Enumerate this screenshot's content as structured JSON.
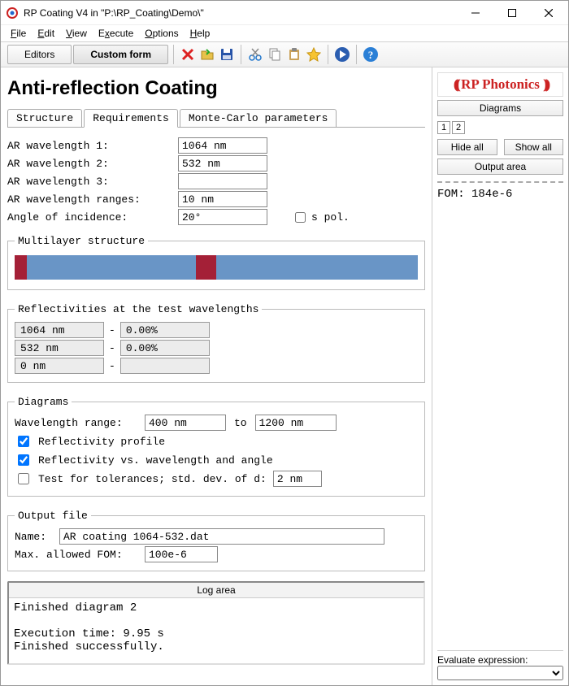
{
  "window": {
    "title": "RP Coating V4 in \"P:\\RP_Coating\\Demo\\\""
  },
  "menubar": [
    "File",
    "Edit",
    "View",
    "Execute",
    "Options",
    "Help"
  ],
  "toolbar": {
    "editors": "Editors",
    "custom": "Custom form"
  },
  "page": {
    "heading": "Anti-reflection Coating",
    "tabs": [
      "Structure",
      "Requirements",
      "Monte-Carlo parameters"
    ],
    "activeTab": 1,
    "fields": {
      "ar1_label": "AR wavelength 1:",
      "ar1_value": "1064 nm",
      "ar2_label": "AR wavelength 2:",
      "ar2_value": "532 nm",
      "ar3_label": "AR wavelength 3:",
      "ar3_value": "",
      "arranges_label": "AR wavelength ranges:",
      "arranges_value": "10 nm",
      "angle_label": "Angle of incidence:",
      "angle_value": "20°",
      "spol_label": "s pol."
    },
    "multi": {
      "legend": "Multilayer structure",
      "segments": [
        {
          "class": "dark",
          "w": 3
        },
        {
          "class": "light",
          "w": 42
        },
        {
          "class": "dark",
          "w": 5
        },
        {
          "class": "light",
          "w": 50
        }
      ]
    },
    "refl": {
      "legend": "Reflectivities at the test wavelengths",
      "rows": [
        {
          "wl": "1064 nm",
          "val": "0.00%"
        },
        {
          "wl": "532 nm",
          "val": "0.00%"
        },
        {
          "wl": "0 nm",
          "val": ""
        }
      ]
    },
    "diagrams": {
      "legend": "Diagrams",
      "range_label": "Wavelength range:",
      "range_from": "400 nm",
      "range_to_word": "to",
      "range_to": "1200 nm",
      "chk1": "Reflectivity profile",
      "chk2": "Reflectivity vs. wavelength and angle",
      "chk3": "Test for tolerances; std. dev. of d:",
      "tol_value": "2 nm"
    },
    "output": {
      "legend": "Output file",
      "name_label": "Name:",
      "name_value": "AR coating 1064-532.dat",
      "fom_label": "Max. allowed FOM:",
      "fom_value": "100e-6"
    }
  },
  "log": {
    "header": "Log area",
    "body": "Finished diagram 2\n\nExecution time: 9.95 s\nFinished successfully."
  },
  "side": {
    "logo_mid": "RP Photonics",
    "diagrams_hdr": "Diagrams",
    "numtabs": [
      "1",
      "2"
    ],
    "hide": "Hide all",
    "show": "Show all",
    "output_hdr": "Output area",
    "output_body": "FOM: 184e-6",
    "eval_label": "Evaluate expression:"
  }
}
